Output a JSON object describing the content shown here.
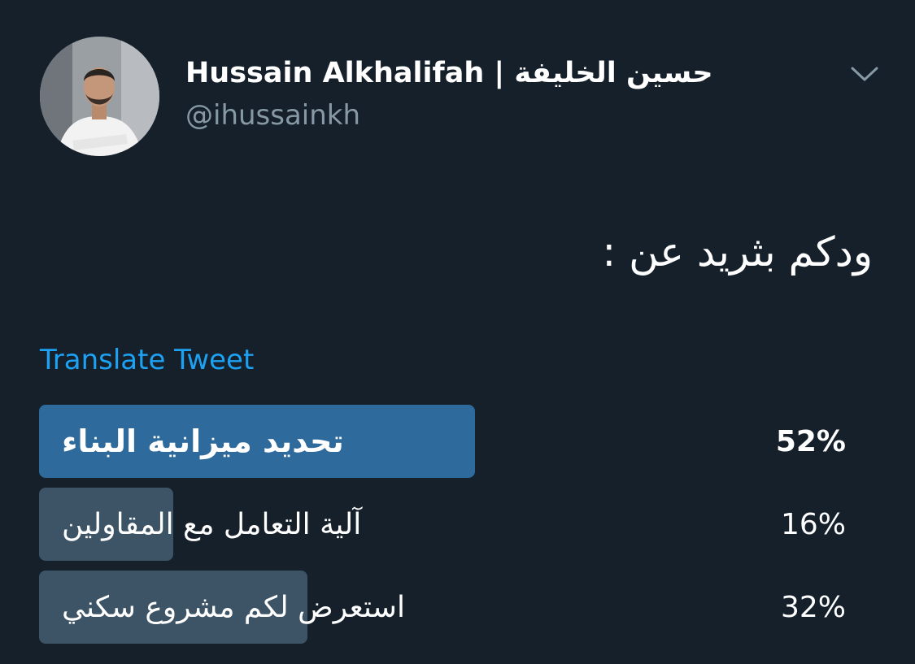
{
  "header": {
    "display_name": "Hussain Alkhalifah | حسين الخليفة",
    "handle": "@ihussainkh",
    "avatar_icon": "profile-photo",
    "menu_icon": "chevron-down-icon"
  },
  "tweet": {
    "text": "ودكم بثريد عن :",
    "translate_label": "Translate Tweet"
  },
  "poll": {
    "options": [
      {
        "label": "تحديد ميزانية البناء",
        "percent_text": "52%",
        "percent": 52,
        "leading": true
      },
      {
        "label": "آلية التعامل مع المقاولين",
        "percent_text": "16%",
        "percent": 16,
        "leading": false
      },
      {
        "label": "استعرض لكم مشروع سكني",
        "percent_text": "32%",
        "percent": 32,
        "leading": false
      }
    ]
  },
  "colors": {
    "background": "#15202b",
    "text": "#ffffff",
    "muted": "#8899a6",
    "link": "#1da1f2",
    "leading_bar": "#2e6a9c",
    "bar": "#3d5466"
  }
}
